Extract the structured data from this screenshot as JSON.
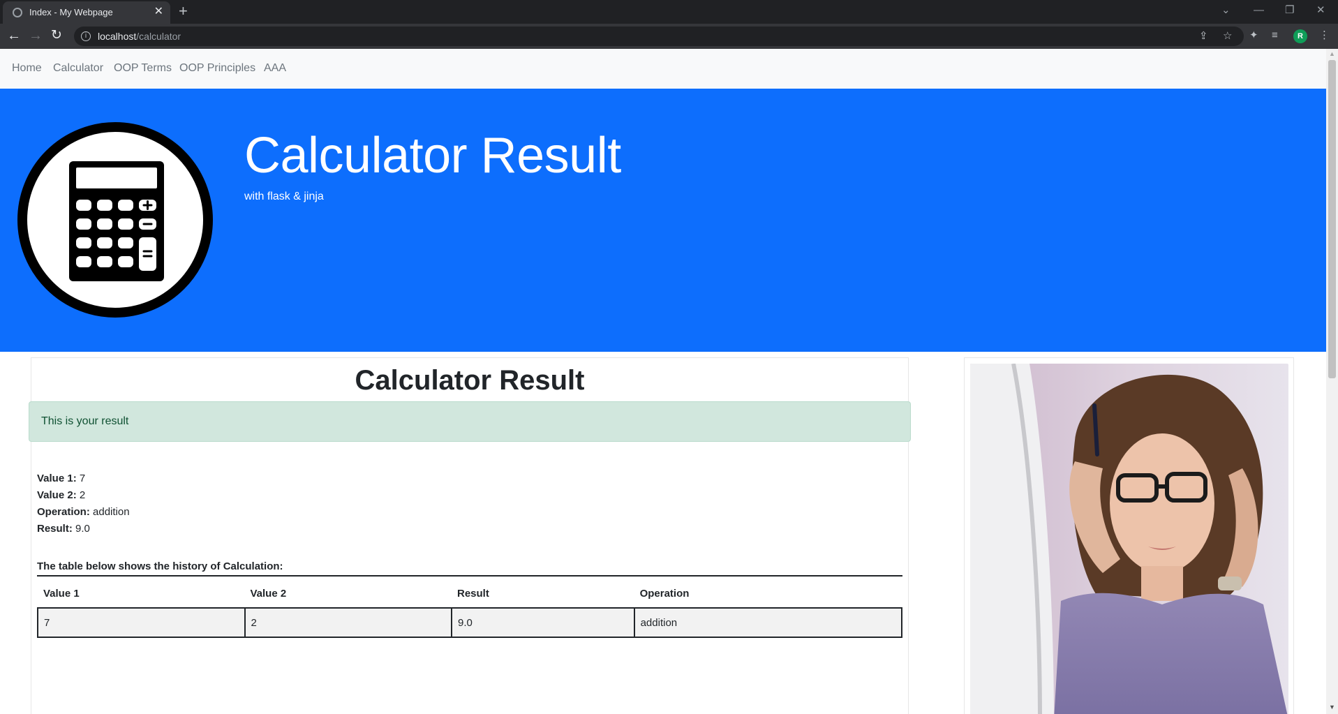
{
  "browser": {
    "tab_title": "Index - My Webpage",
    "tab_close": "✕",
    "new_tab": "+",
    "url_host": "localhost",
    "url_path": "/calculator",
    "avatar_initial": "R"
  },
  "navbar": {
    "links": [
      "Home",
      "Calculator",
      "OOP Terms",
      "OOP Principles",
      "AAA"
    ]
  },
  "hero": {
    "title": "Calculator Result",
    "subtitle": "with flask & jinja",
    "bg_color": "#0d6efd",
    "logo_icon": "calculator-icon"
  },
  "main": {
    "heading": "Calculator Result",
    "alert": "This is your result",
    "alert_color": "#d1e7dd",
    "values": [
      {
        "label": "Value 1:",
        "value": "7"
      },
      {
        "label": "Value 2:",
        "value": "2"
      },
      {
        "label": "Operation:",
        "value": "addition"
      },
      {
        "label": "Result:",
        "value": "9.0"
      }
    ],
    "history_caption": "The table below shows the history of Calculation:",
    "table": {
      "headers": [
        "Value 1",
        "Value 2",
        "Result",
        "Operation"
      ],
      "rows": [
        [
          "7",
          "2",
          "9.0",
          "addition"
        ]
      ]
    }
  },
  "sidebar": {
    "image": "stressed-woman-at-laptop-photo"
  }
}
